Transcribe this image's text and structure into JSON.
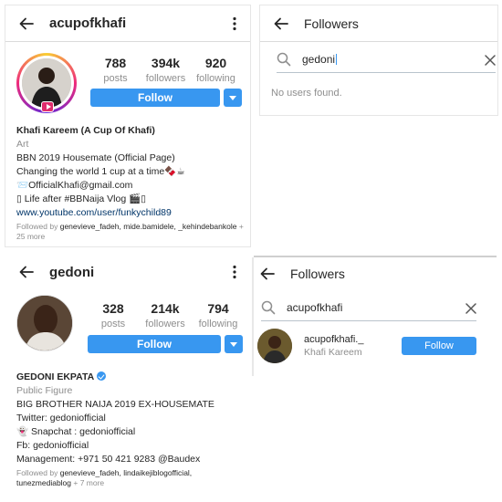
{
  "profile1": {
    "username": "acupofkhafi",
    "stats": [
      {
        "value": "788",
        "label": "posts"
      },
      {
        "value": "394k",
        "label": "followers"
      },
      {
        "value": "920",
        "label": "following"
      }
    ],
    "follow_label": "Follow",
    "full_name": "Khafi Kareem (A Cup Of Khafi)",
    "category": "Art",
    "bio_lines": [
      "BBN 2019 Housemate (Official Page)",
      "Changing the world 1 cup at a time🍫☕",
      "📨OfficialKhafi@gmail.com",
      "▯ Life after #BBNaija Vlog 🎬▯"
    ],
    "link": "www.youtube.com/user/funkychild89",
    "followed_by_prefix": "Followed by ",
    "followed_by_names": "genevieve_fadeh, mide.bamidele, _kehindebankole",
    "followed_by_more": " + 25 more"
  },
  "profile2": {
    "username": "gedoni",
    "stats": [
      {
        "value": "328",
        "label": "posts"
      },
      {
        "value": "214k",
        "label": "followers"
      },
      {
        "value": "794",
        "label": "following"
      }
    ],
    "follow_label": "Follow",
    "full_name": "GEDONI EKPATA",
    "category": "Public Figure",
    "bio_lines": [
      "BIG BROTHER NAIJA 2019 EX-HOUSEMATE",
      "Twitter: gedoniofficial",
      "👻 Snapchat : gedoniofficial",
      "Fb: gedoniofficial",
      "Management: +971 50 421 9283 @Baudex"
    ],
    "followed_by_prefix": "Followed by ",
    "followed_by_names": "genevieve_fadeh, lindaikejiblogofficial, tunezmediablog",
    "followed_by_more": " + 7 more"
  },
  "followers1": {
    "title": "Followers",
    "query": "gedoni",
    "empty_text": "No users found."
  },
  "followers2": {
    "title": "Followers",
    "query": "acupofkhafi",
    "result_username": "acupofkhafi._",
    "result_fullname": "Khafi Kareem",
    "follow_label": "Follow"
  },
  "colors": {
    "accent": "#3897f0",
    "link": "#003569",
    "muted": "#8e8e8e"
  }
}
